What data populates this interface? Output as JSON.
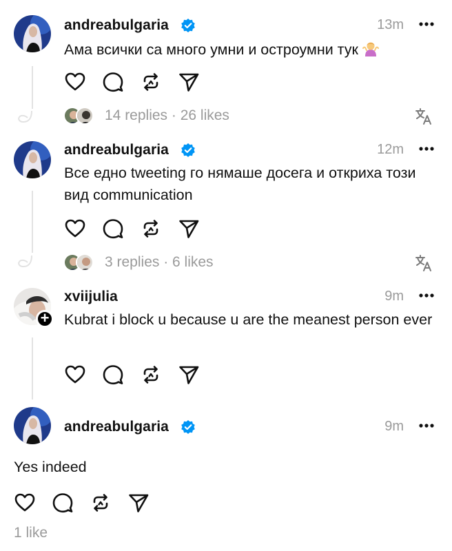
{
  "posts": [
    {
      "username": "andreabulgaria",
      "verified": true,
      "time": "13m",
      "text": "Ама всички са много умни и остроумни тук",
      "emoji": "woman-shrugging",
      "stats": "14 replies · 26 likes"
    },
    {
      "username": "andreabulgaria",
      "verified": true,
      "time": "12m",
      "text": "Все едно tweeting го нямаше досега и откриха този вид communication",
      "stats": "3 replies · 6 likes"
    },
    {
      "username": "xviijulia",
      "verified": false,
      "time": "9m",
      "text": "Kubrat i block u because u are the meanest person ever"
    },
    {
      "username": "andreabulgaria",
      "verified": true,
      "time": "9m",
      "text": "Yes indeed",
      "stats": "1 like"
    }
  ],
  "icons": {
    "like": "heart-icon",
    "reply": "comment-icon",
    "repost": "repost-icon",
    "share": "send-icon",
    "more": "more-icon",
    "translate": "translate-icon",
    "verified": "verified-badge-icon"
  },
  "colors": {
    "text": "#101010",
    "muted": "#9a9a9a",
    "verified": "#0095f6",
    "thread_line": "#e2e2e2"
  }
}
